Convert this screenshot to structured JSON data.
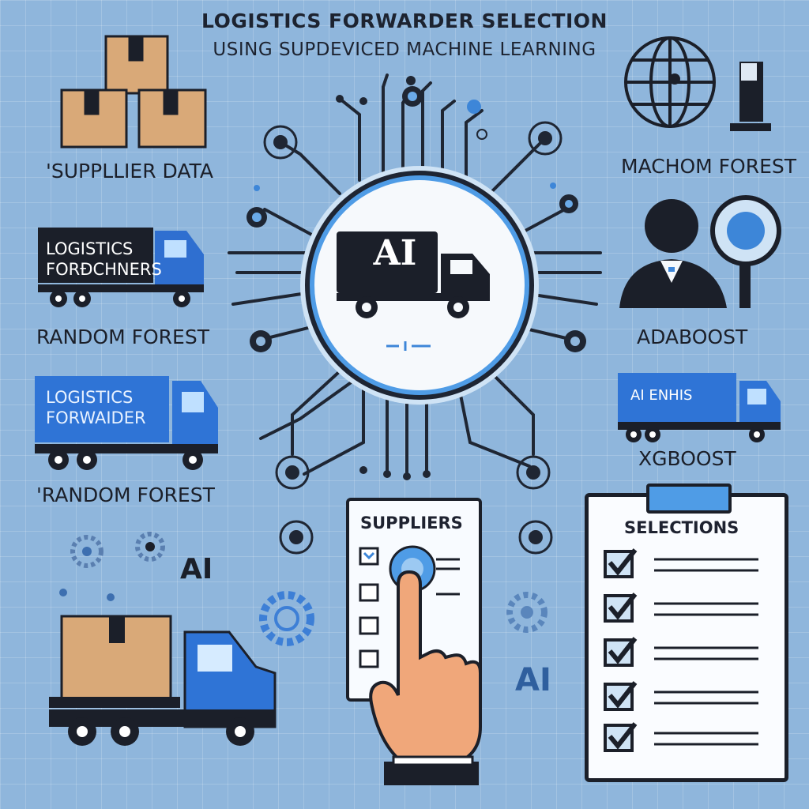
{
  "title": {
    "line1": "LOGISTICS FORWARDER SELECTION",
    "line2": "USING SUPDEVICED MACHINE LEARNING"
  },
  "hub": {
    "label": "AI",
    "icon": "truck-icon"
  },
  "left_labels": {
    "supplier_data": "'SUPPLLIER DATA",
    "random_forest_1": "RANDOM FOREST",
    "random_forest_2": "'RANDOM FOREST"
  },
  "left_trucks": {
    "truck1_text": "LOGISTICS FORÐCHNERS",
    "truck2_text": "LOGISTICS FORWAIDER"
  },
  "right_labels": {
    "machom_forest": "MACHOM FOREST",
    "adaboost": "ADABOOST",
    "xgboost": "XGBOOST"
  },
  "right_truck_text": "AI  ENHIS",
  "bottom": {
    "ai_left": "AI",
    "ai_center": "AI",
    "suppliers_title": "SUPPLIERS",
    "selections_title": "SELECTIONS"
  },
  "colors": {
    "background": "#8fb6dc",
    "accent_blue": "#3d7fd6",
    "dark": "#1e2533",
    "box": "#d9a978"
  }
}
